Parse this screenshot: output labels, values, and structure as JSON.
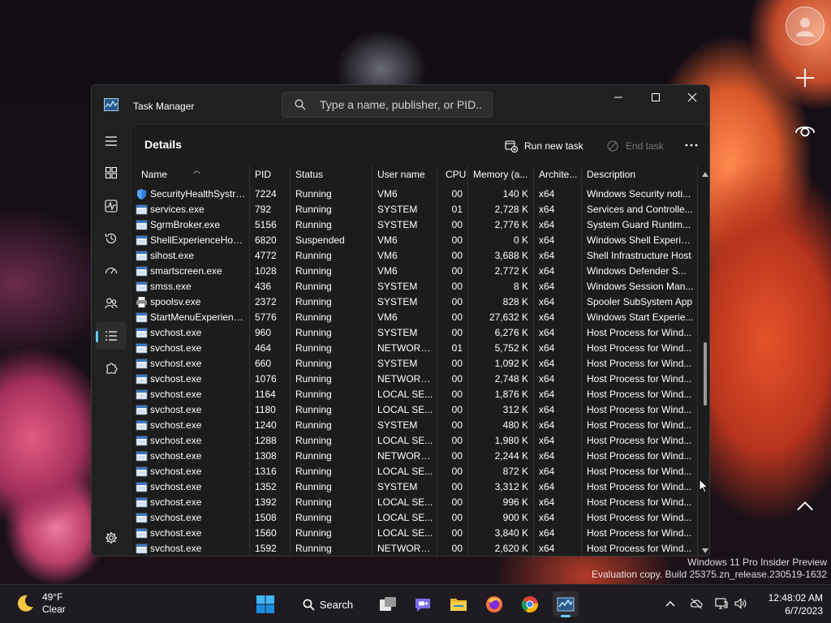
{
  "window": {
    "title": "Task Manager",
    "search_placeholder": "Type a name, publisher, or PID..."
  },
  "page": {
    "title": "Details",
    "run_new_task": "Run new task",
    "end_task": "End task"
  },
  "columns": [
    "Name",
    "PID",
    "Status",
    "User name",
    "CPU",
    "Memory (a...",
    "Archite...",
    "Description"
  ],
  "processes": [
    {
      "name": "SecurityHealthSystra...",
      "pid": "7224",
      "status": "Running",
      "user": "VM6",
      "cpu": "00",
      "memory": "140 K",
      "arch": "x64",
      "desc": "Windows Security noti...",
      "icon": "shield-icon"
    },
    {
      "name": "services.exe",
      "pid": "792",
      "status": "Running",
      "user": "SYSTEM",
      "cpu": "01",
      "memory": "2,728 K",
      "arch": "x64",
      "desc": "Services and Controlle...",
      "icon": "app-window-icon"
    },
    {
      "name": "SgrmBroker.exe",
      "pid": "5156",
      "status": "Running",
      "user": "SYSTEM",
      "cpu": "00",
      "memory": "2,776 K",
      "arch": "x64",
      "desc": "System Guard Runtim...",
      "icon": "app-window-icon"
    },
    {
      "name": "ShellExperienceHost....",
      "pid": "6820",
      "status": "Suspended",
      "user": "VM6",
      "cpu": "00",
      "memory": "0 K",
      "arch": "x64",
      "desc": "Windows Shell Experie...",
      "icon": "app-window-icon"
    },
    {
      "name": "sihost.exe",
      "pid": "4772",
      "status": "Running",
      "user": "VM6",
      "cpu": "00",
      "memory": "3,688 K",
      "arch": "x64",
      "desc": "Shell Infrastructure Host",
      "icon": "app-window-icon"
    },
    {
      "name": "smartscreen.exe",
      "pid": "1028",
      "status": "Running",
      "user": "VM6",
      "cpu": "00",
      "memory": "2,772 K",
      "arch": "x64",
      "desc": "Windows Defender S...",
      "icon": "app-window-icon"
    },
    {
      "name": "smss.exe",
      "pid": "436",
      "status": "Running",
      "user": "SYSTEM",
      "cpu": "00",
      "memory": "8 K",
      "arch": "x64",
      "desc": "Windows Session Man...",
      "icon": "app-window-icon"
    },
    {
      "name": "spoolsv.exe",
      "pid": "2372",
      "status": "Running",
      "user": "SYSTEM",
      "cpu": "00",
      "memory": "828 K",
      "arch": "x64",
      "desc": "Spooler SubSystem App",
      "icon": "printer-icon"
    },
    {
      "name": "StartMenuExperienc...",
      "pid": "5776",
      "status": "Running",
      "user": "VM6",
      "cpu": "00",
      "memory": "27,632 K",
      "arch": "x64",
      "desc": "Windows Start Experie...",
      "icon": "app-window-icon"
    },
    {
      "name": "svchost.exe",
      "pid": "960",
      "status": "Running",
      "user": "SYSTEM",
      "cpu": "00",
      "memory": "6,276 K",
      "arch": "x64",
      "desc": "Host Process for Wind...",
      "icon": "app-window-icon"
    },
    {
      "name": "svchost.exe",
      "pid": "464",
      "status": "Running",
      "user": "NETWORK...",
      "cpu": "01",
      "memory": "5,752 K",
      "arch": "x64",
      "desc": "Host Process for Wind...",
      "icon": "app-window-icon"
    },
    {
      "name": "svchost.exe",
      "pid": "660",
      "status": "Running",
      "user": "SYSTEM",
      "cpu": "00",
      "memory": "1,092 K",
      "arch": "x64",
      "desc": "Host Process for Wind...",
      "icon": "app-window-icon"
    },
    {
      "name": "svchost.exe",
      "pid": "1076",
      "status": "Running",
      "user": "NETWORK...",
      "cpu": "00",
      "memory": "2,748 K",
      "arch": "x64",
      "desc": "Host Process for Wind...",
      "icon": "app-window-icon"
    },
    {
      "name": "svchost.exe",
      "pid": "1164",
      "status": "Running",
      "user": "LOCAL SE...",
      "cpu": "00",
      "memory": "1,876 K",
      "arch": "x64",
      "desc": "Host Process for Wind...",
      "icon": "app-window-icon"
    },
    {
      "name": "svchost.exe",
      "pid": "1180",
      "status": "Running",
      "user": "LOCAL SE...",
      "cpu": "00",
      "memory": "312 K",
      "arch": "x64",
      "desc": "Host Process for Wind...",
      "icon": "app-window-icon"
    },
    {
      "name": "svchost.exe",
      "pid": "1240",
      "status": "Running",
      "user": "SYSTEM",
      "cpu": "00",
      "memory": "480 K",
      "arch": "x64",
      "desc": "Host Process for Wind...",
      "icon": "app-window-icon"
    },
    {
      "name": "svchost.exe",
      "pid": "1288",
      "status": "Running",
      "user": "LOCAL SE...",
      "cpu": "00",
      "memory": "1,980 K",
      "arch": "x64",
      "desc": "Host Process for Wind...",
      "icon": "app-window-icon"
    },
    {
      "name": "svchost.exe",
      "pid": "1308",
      "status": "Running",
      "user": "NETWORK...",
      "cpu": "00",
      "memory": "2,244 K",
      "arch": "x64",
      "desc": "Host Process for Wind...",
      "icon": "app-window-icon"
    },
    {
      "name": "svchost.exe",
      "pid": "1316",
      "status": "Running",
      "user": "LOCAL SE...",
      "cpu": "00",
      "memory": "872 K",
      "arch": "x64",
      "desc": "Host Process for Wind...",
      "icon": "app-window-icon"
    },
    {
      "name": "svchost.exe",
      "pid": "1352",
      "status": "Running",
      "user": "SYSTEM",
      "cpu": "00",
      "memory": "3,312 K",
      "arch": "x64",
      "desc": "Host Process for Wind...",
      "icon": "app-window-icon"
    },
    {
      "name": "svchost.exe",
      "pid": "1392",
      "status": "Running",
      "user": "LOCAL SE...",
      "cpu": "00",
      "memory": "996 K",
      "arch": "x64",
      "desc": "Host Process for Wind...",
      "icon": "app-window-icon"
    },
    {
      "name": "svchost.exe",
      "pid": "1508",
      "status": "Running",
      "user": "LOCAL SE...",
      "cpu": "00",
      "memory": "900 K",
      "arch": "x64",
      "desc": "Host Process for Wind...",
      "icon": "app-window-icon"
    },
    {
      "name": "svchost.exe",
      "pid": "1560",
      "status": "Running",
      "user": "LOCAL SE...",
      "cpu": "00",
      "memory": "3,840 K",
      "arch": "x64",
      "desc": "Host Process for Wind...",
      "icon": "app-window-icon"
    },
    {
      "name": "svchost.exe",
      "pid": "1592",
      "status": "Running",
      "user": "NETWORK...",
      "cpu": "00",
      "memory": "2,620 K",
      "arch": "x64",
      "desc": "Host Process for Wind...",
      "icon": "app-window-icon"
    }
  ],
  "desktop": {
    "watermark_line1": "Windows 11 Pro Insider Preview",
    "watermark_line2": "Evaluation copy. Build 25375.zn_release.230519-1632"
  },
  "taskbar": {
    "weather_temp": "49°F",
    "weather_cond": "Clear",
    "search_label": "Search",
    "time": "12:48:02 AM",
    "date": "6/7/2023"
  },
  "colors": {
    "accent": "#60cdff",
    "window_bg": "#202020",
    "content_bg": "#1c1c1c"
  }
}
